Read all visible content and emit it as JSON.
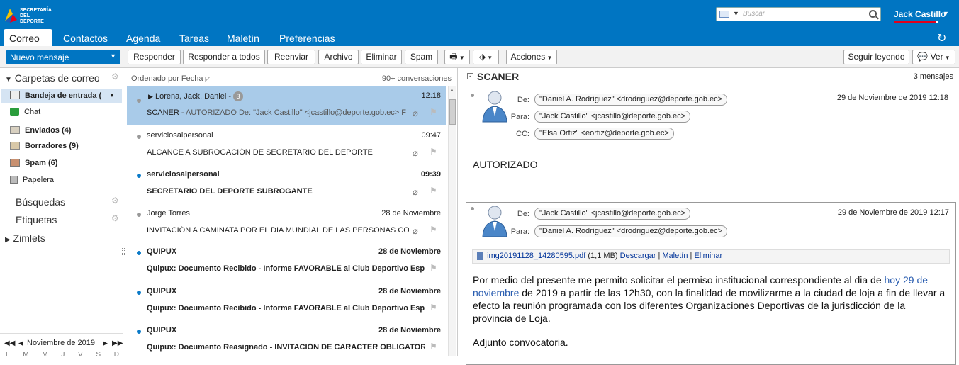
{
  "app": {
    "logo_text": "SECRETARÍA DEL DEPORTE",
    "search_placeholder": "Buscar",
    "user_name": "Jack Castillo",
    "tabs": [
      "Correo",
      "Contactos",
      "Agenda",
      "Tareas",
      "Maletín",
      "Preferencias"
    ],
    "active_tab": "Correo",
    "brand_color": "#0075c2"
  },
  "toolbar": {
    "new_message": "Nuevo mensaje",
    "reply": "Responder",
    "reply_all": "Responder a todos",
    "forward": "Reenviar",
    "archive": "Archivo",
    "delete": "Eliminar",
    "spam": "Spam",
    "actions": "Acciones",
    "keep_reading": "Seguir leyendo",
    "view": "Ver"
  },
  "sidebar": {
    "mail_folders_header": "Carpetas de correo",
    "folders": [
      {
        "label": "Bandeja de entrada (",
        "bold": true,
        "icon": "inbox-icon"
      },
      {
        "label": "Chat",
        "bold": false,
        "icon": "chat-icon"
      },
      {
        "label": "Enviados (4)",
        "bold": true,
        "icon": "sent-folder-icon"
      },
      {
        "label": "Borradores (9)",
        "bold": true,
        "icon": "drafts-folder-icon"
      },
      {
        "label": "Spam (6)",
        "bold": true,
        "icon": "spam-folder-icon"
      },
      {
        "label": "Papelera",
        "bold": false,
        "icon": "trash-icon"
      }
    ],
    "searches": "Búsquedas",
    "tags": "Etiquetas",
    "zimlets": "Zimlets",
    "calendar_month": "Noviembre de 2019",
    "calendar_days": [
      "L",
      "M",
      "M",
      "J",
      "V",
      "S",
      "D"
    ]
  },
  "message_list": {
    "sort_label": "Ordenado por Fecha",
    "count_label": "90+ conversaciones",
    "messages": [
      {
        "from": "Lorena, Jack, Daniel -",
        "badge": "3",
        "time": "12:18",
        "subject": "SCANER",
        "preview": " - AUTORIZADO De: \"Jack Castillo\" <jcastillo@deporte.gob.ec> F",
        "unread": false,
        "selected": true,
        "attachment": true
      },
      {
        "from": "serviciosalpersonal",
        "badge": "",
        "time": "09:47",
        "subject": "ALCANCE A SUBROGACIÓN DE SECRETARIO DEL DEPORTE",
        "preview": "",
        "unread": false,
        "selected": false,
        "attachment": true
      },
      {
        "from": "serviciosalpersonal",
        "badge": "",
        "time": "09:39",
        "subject": "SECRETARIO DEL DEPORTE SUBROGANTE",
        "preview": "",
        "unread": true,
        "selected": false,
        "attachment": true
      },
      {
        "from": "Jorge Torres",
        "badge": "",
        "time": "28 de Noviembre",
        "subject": "INVITACIÓN A CAMINATA POR EL DIA MUNDIAL DE  LAS PERSONAS CON",
        "preview": "",
        "unread": false,
        "selected": false,
        "attachment": true
      },
      {
        "from": "QUIPUX",
        "badge": "",
        "time": "28 de Noviembre",
        "subject": "Quipux: Documento Recibido  - Informe FAVORABLE al Club Deportivo Espe",
        "preview": "",
        "unread": true,
        "selected": false,
        "attachment": false
      },
      {
        "from": "QUIPUX",
        "badge": "",
        "time": "28 de Noviembre",
        "subject": "Quipux: Documento Recibido  - Informe FAVORABLE al Club Deportivo Espe",
        "preview": "",
        "unread": true,
        "selected": false,
        "attachment": false
      },
      {
        "from": "QUIPUX",
        "badge": "",
        "time": "28 de Noviembre",
        "subject": "Quipux: Documento Reasignado  - INVITACIÓN DE CARACTER OBLIGATORIO",
        "preview": "",
        "unread": true,
        "selected": false,
        "attachment": false
      }
    ]
  },
  "reading_pane": {
    "title": "SCANER",
    "count": "3 mensajes",
    "msg1": {
      "from_label": "De:",
      "from": "\"Daniel A. Rodríguez\" <drodriguez@deporte.gob.ec>",
      "to_label": "Para:",
      "to": "\"Jack Castillo\" <jcastillo@deporte.gob.ec>",
      "cc_label": "CC:",
      "cc": "\"Elsa Ortiz\" <eortiz@deporte.gob.ec>",
      "date": "29 de Noviembre de 2019 12:18",
      "body": "AUTORIZADO"
    },
    "msg2": {
      "from_label": "De:",
      "from": "\"Jack Castillo\" <jcastillo@deporte.gob.ec>",
      "to_label": "Para:",
      "to": "\"Daniel A. Rodríguez\" <drodriguez@deporte.gob.ec>",
      "date": "29 de Noviembre de 2019 12:17",
      "attachment_name": "img20191128_14280595.pdf",
      "attachment_size": "(1,1 MB)",
      "download": "Descargar",
      "briefcase": "Maletín",
      "remove": "Eliminar",
      "body_part1": "Por medio del presente me permito solicitar el permiso institucional correspondiente al dia de ",
      "body_link": "hoy 29 de noviembre",
      "body_part2": " de 2019 a partir de las 12h30, con la finalidad de movilizarme a la ciudad de loja a fin de llevar a efecto la reunión programada con los diferentes Organizaciones Deportivas de la jurisdicción de la provincia de Loja.",
      "body_closing": "Adjunto convocatoria."
    }
  }
}
